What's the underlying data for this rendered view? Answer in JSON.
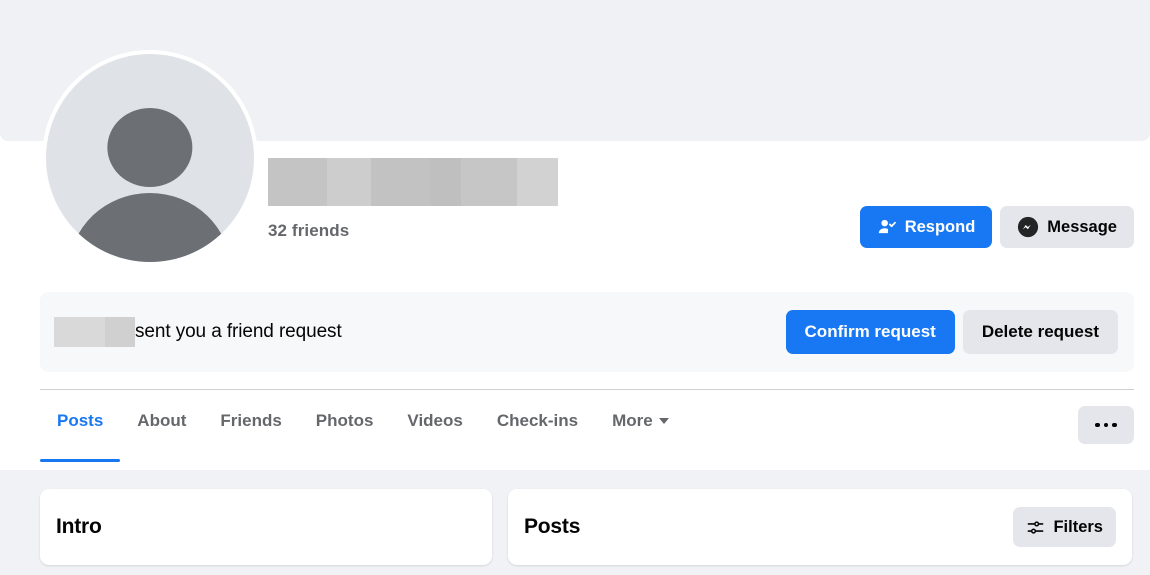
{
  "profile": {
    "name_redacted": true,
    "friend_count_label": "32 friends",
    "avatar_icon": "default-person-avatar",
    "name_redaction_bands": [
      "#c4c4c4",
      "#cdcdcd",
      "#c2c2c2",
      "#bfbfbf",
      "#c6c6c6",
      "#d2d2d2"
    ]
  },
  "header_actions": {
    "respond_label": "Respond",
    "respond_icon": "person-check-icon",
    "message_label": "Message",
    "message_icon": "messenger-icon"
  },
  "friend_request": {
    "name_redaction_bands": [
      "#d9d9d9",
      "#d0d0d0"
    ],
    "text": "sent you a friend request",
    "confirm_label": "Confirm request",
    "delete_label": "Delete request"
  },
  "nav": {
    "tabs": [
      {
        "label": "Posts",
        "active": true
      },
      {
        "label": "About",
        "active": false
      },
      {
        "label": "Friends",
        "active": false
      },
      {
        "label": "Photos",
        "active": false
      },
      {
        "label": "Videos",
        "active": false
      },
      {
        "label": "Check-ins",
        "active": false
      },
      {
        "label": "More",
        "active": false,
        "has_chevron": true
      }
    ],
    "more_options_icon": "ellipsis-horizontal-icon"
  },
  "cards": {
    "intro_title": "Intro",
    "posts_title": "Posts",
    "filters_label": "Filters",
    "filters_icon": "sliders-icon"
  },
  "colors": {
    "accent": "#1877f2",
    "page_background": "#f0f2f5",
    "cover_background": "#eff1f4",
    "secondary_button": "#e4e6eb",
    "banner_background": "#f7f8fa",
    "muted_text": "#65676b"
  }
}
